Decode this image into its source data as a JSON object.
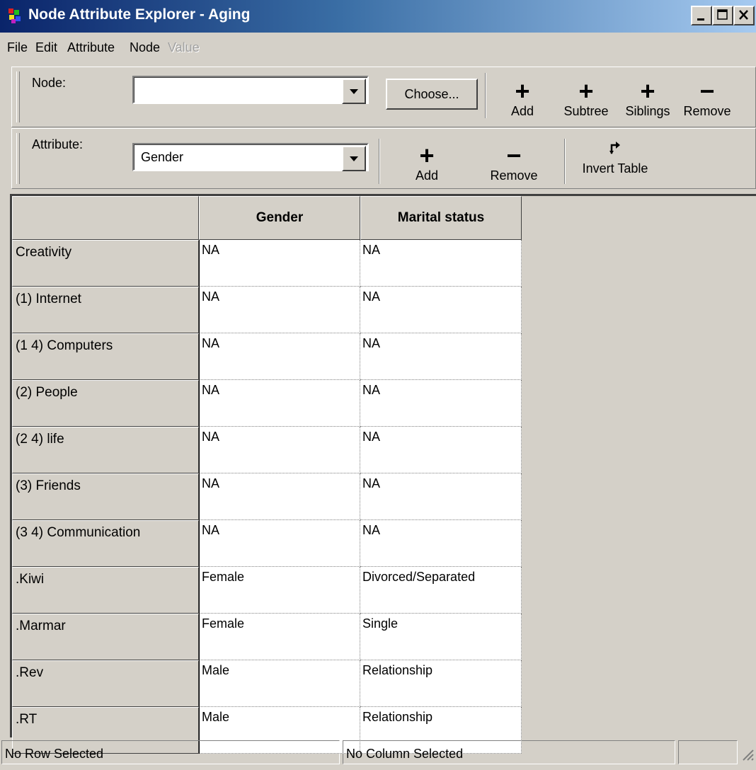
{
  "window": {
    "title": "Node Attribute Explorer - Aging"
  },
  "menu": [
    {
      "label": "File",
      "enabled": true
    },
    {
      "label": "Edit",
      "enabled": true
    },
    {
      "label": "Attribute",
      "enabled": true
    },
    {
      "label": "Node",
      "enabled": true
    },
    {
      "label": "Value",
      "enabled": false
    }
  ],
  "node_toolbar": {
    "label": "Node:",
    "value": "",
    "choose_label": "Choose...",
    "buttons": [
      {
        "icon": "plus-icon",
        "label": "Add"
      },
      {
        "icon": "plus-icon",
        "label": "Subtree"
      },
      {
        "icon": "plus-icon",
        "label": "Siblings"
      },
      {
        "icon": "minus-icon",
        "label": "Remove"
      }
    ]
  },
  "attribute_toolbar": {
    "label": "Attribute:",
    "value": "Gender",
    "buttons": [
      {
        "icon": "plus-icon",
        "label": "Add"
      },
      {
        "icon": "minus-icon",
        "label": "Remove"
      },
      {
        "icon": "swap-arrows-icon",
        "label": "Invert Table"
      }
    ]
  },
  "table": {
    "columns": [
      "Gender",
      "Marital status"
    ],
    "rows": [
      {
        "name": "Creativity",
        "values": [
          "NA",
          "NA"
        ]
      },
      {
        "name": "(1) Internet",
        "values": [
          "NA",
          "NA"
        ]
      },
      {
        "name": "(1 4) Computers",
        "values": [
          "NA",
          "NA"
        ]
      },
      {
        "name": "(2) People",
        "values": [
          "NA",
          "NA"
        ]
      },
      {
        "name": "(2 4) life",
        "values": [
          "NA",
          "NA"
        ]
      },
      {
        "name": "(3) Friends",
        "values": [
          "NA",
          "NA"
        ]
      },
      {
        "name": "(3 4) Communication",
        "values": [
          "NA",
          "NA"
        ]
      },
      {
        "name": ".Kiwi",
        "values": [
          "Female",
          "Divorced/Separated"
        ]
      },
      {
        "name": ".Marmar",
        "values": [
          "Female",
          "Single"
        ]
      },
      {
        "name": ".Rev",
        "values": [
          "Male",
          "Relationship"
        ]
      },
      {
        "name": ".RT",
        "values": [
          "Male",
          "Relationship"
        ]
      }
    ]
  },
  "status": {
    "row": "No Row Selected",
    "column": "No Column Selected",
    "extra": ""
  }
}
